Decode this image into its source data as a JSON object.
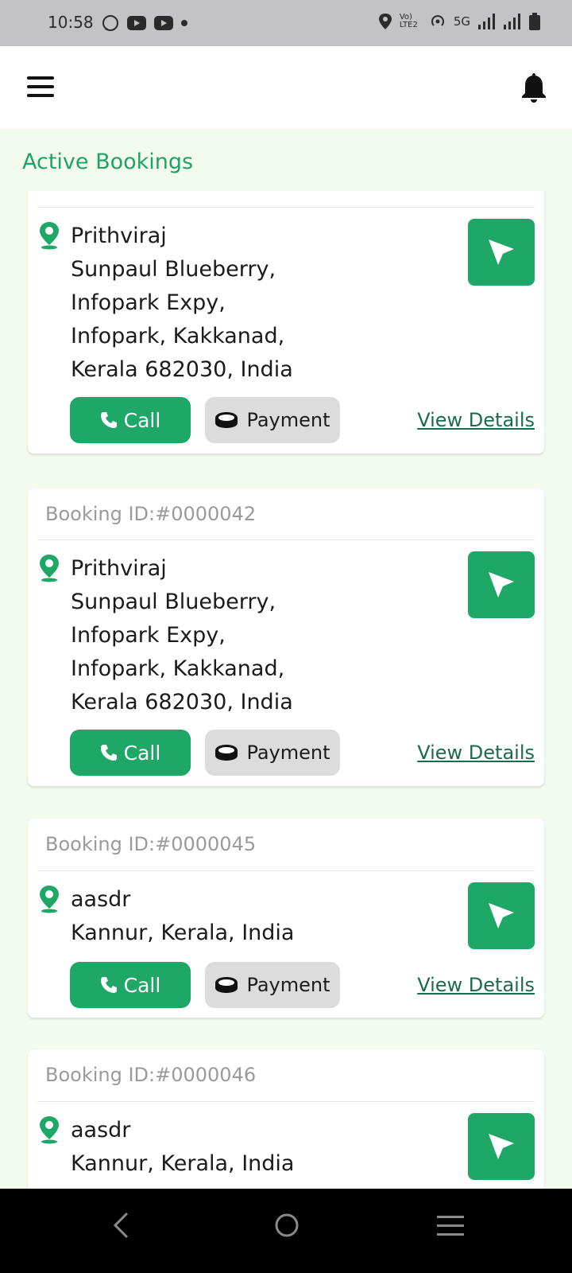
{
  "status_bar": {
    "time": "10:58",
    "network": "5G",
    "volte": "Vo) LTE2"
  },
  "header": {
    "menu_icon": "hamburger-menu-icon",
    "notification_icon": "bell-icon"
  },
  "section_title": "Active Bookings",
  "bookings": [
    {
      "id_label": "",
      "name": "Prithviraj",
      "address_lines": [
        "Sunpaul Blueberry,",
        "Infopark Expy,",
        "Infopark, Kakkanad,",
        "Kerala 682030, India"
      ],
      "call_label": "Call",
      "payment_label": "Payment",
      "details_label": "View Details"
    },
    {
      "id_label": "Booking ID:#0000042",
      "name": "Prithviraj",
      "address_lines": [
        "Sunpaul Blueberry,",
        "Infopark Expy,",
        "Infopark, Kakkanad,",
        "Kerala 682030, India"
      ],
      "call_label": "Call",
      "payment_label": "Payment",
      "details_label": "View Details"
    },
    {
      "id_label": "Booking ID:#0000045",
      "name": "aasdr",
      "address_lines": [
        "Kannur, Kerala, India"
      ],
      "call_label": "Call",
      "payment_label": "Payment",
      "details_label": "View Details"
    },
    {
      "id_label": "Booking ID:#0000046",
      "name": "aasdr",
      "address_lines": [
        "Kannur, Kerala, India"
      ]
    }
  ],
  "colors": {
    "accent": "#1ea766",
    "title": "#1ea366",
    "link": "#1a6b4f",
    "background": "#f3fbef"
  }
}
